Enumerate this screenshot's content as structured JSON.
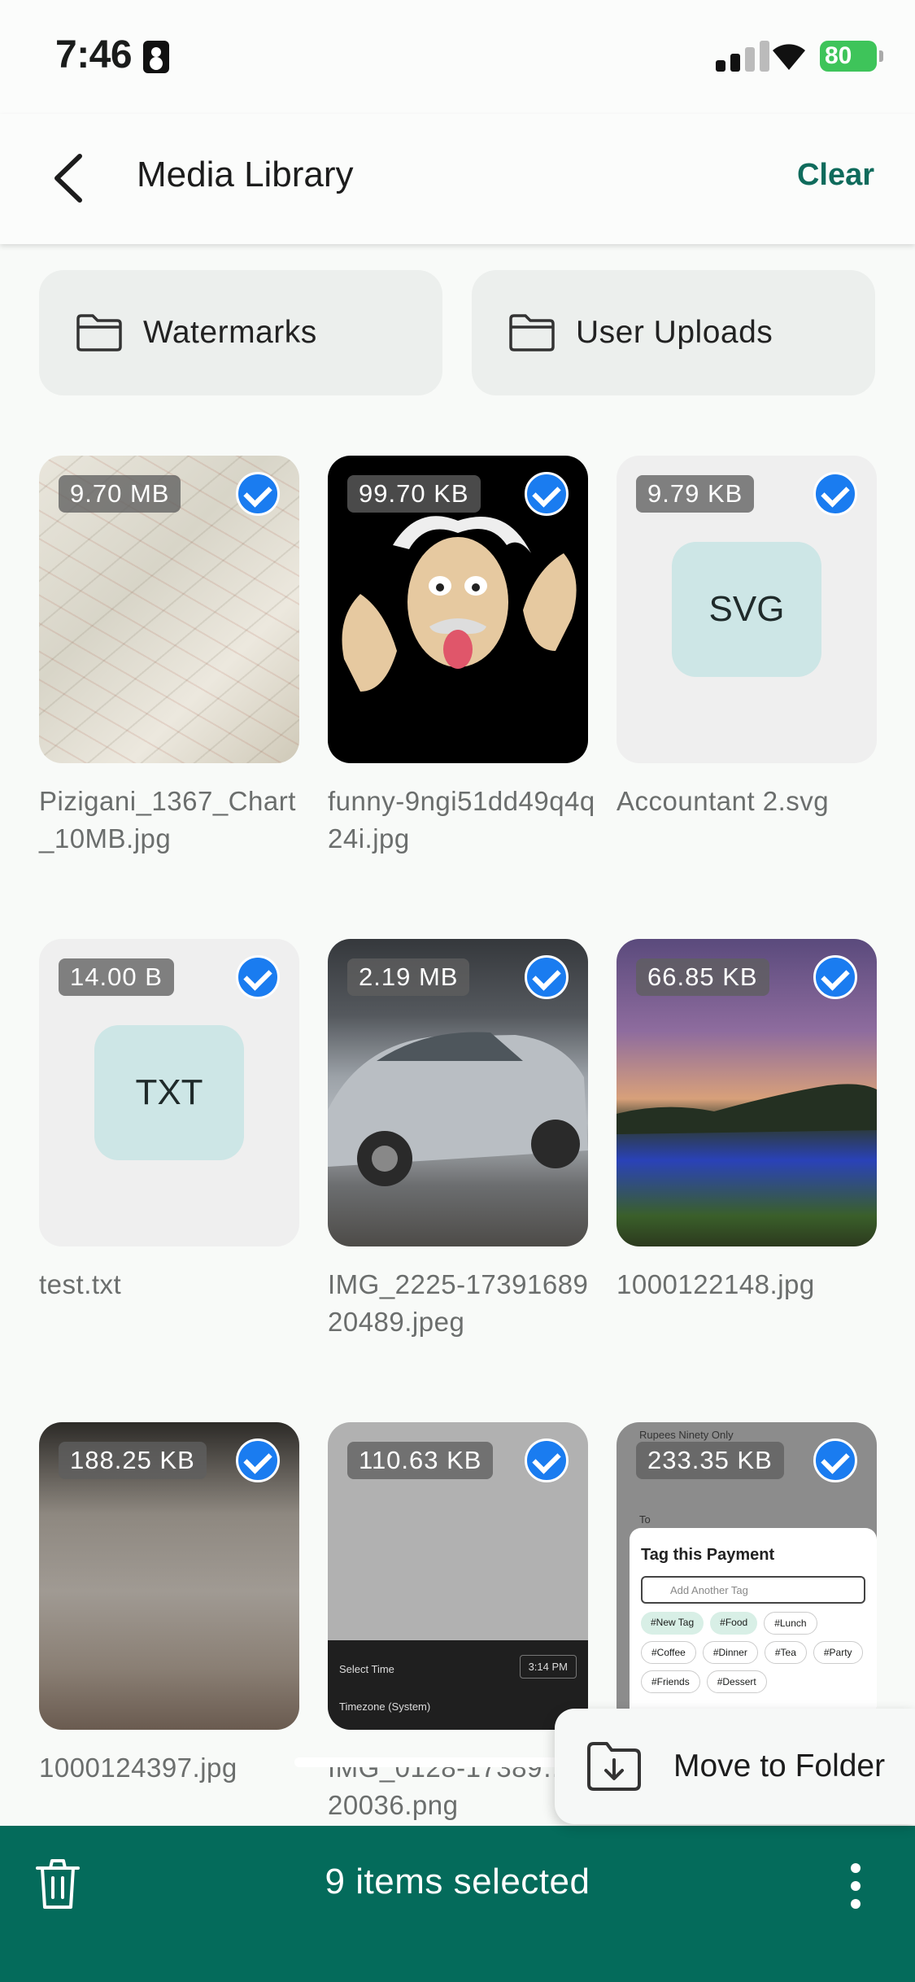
{
  "status": {
    "time": "7:46",
    "battery": "80"
  },
  "appbar": {
    "title": "Media Library",
    "clear_label": "Clear"
  },
  "folders": [
    {
      "name": "Watermarks"
    },
    {
      "name": "User Uploads"
    }
  ],
  "items": [
    {
      "size": "9.70 MB",
      "name": "Pizigani_1367_Chart_10MB.jpg",
      "selected": true
    },
    {
      "size": "99.70 KB",
      "name": "funny-9ngi51dd49q4q24i.jpg",
      "selected": true
    },
    {
      "size": "9.79 KB",
      "name": "Accountant 2.svg",
      "ext": "SVG",
      "selected": true
    },
    {
      "size": "14.00 B",
      "name": "test.txt",
      "ext": "TXT",
      "selected": true
    },
    {
      "size": "2.19 MB",
      "name": "IMG_2225-1739168920489.jpeg",
      "selected": true
    },
    {
      "size": "66.85 KB",
      "name": "1000122148.jpg",
      "selected": true
    },
    {
      "size": "188.25 KB",
      "name": "1000124397.jpg",
      "selected": true
    },
    {
      "size": "110.63 KB",
      "name": "IMG_0128-17389…620036.png",
      "selected": true
    },
    {
      "size": "233.35 KB",
      "name": "",
      "selected": true
    }
  ],
  "thumb_text": {
    "phone": {
      "select_time": "Select Time",
      "time_value": "3:14 PM",
      "timezone": "Timezone (System)"
    },
    "payment": {
      "header": "Rupees Ninety Only",
      "to": "To",
      "sheet_title": "Tag this Payment",
      "placeholder": "Add Another Tag",
      "tags": [
        "#New Tag",
        "#Food",
        "#Lunch",
        "#Coffee",
        "#Dinner",
        "#Tea",
        "#Party",
        "#Friends",
        "#Dessert"
      ]
    }
  },
  "fab": {
    "label": "Move to Folder"
  },
  "bottom": {
    "selection_text": "9 items selected"
  },
  "colors": {
    "accent": "#046b5b",
    "check": "#1a7cf0",
    "clear": "#0f6b5c"
  }
}
